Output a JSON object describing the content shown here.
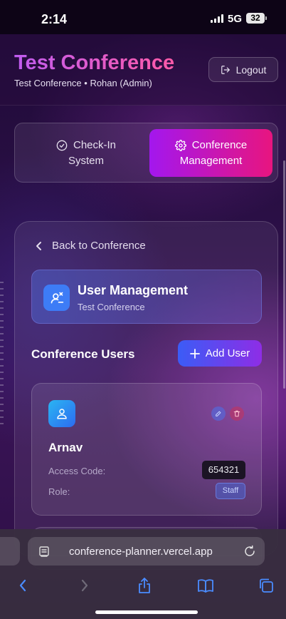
{
  "status_bar": {
    "time": "2:14",
    "network": "5G",
    "battery": "32"
  },
  "header": {
    "title": "Test Conference",
    "subtitle": "Test Conference • Rohan (Admin)",
    "logout_label": "Logout"
  },
  "tabs": [
    {
      "line1": "Check-In",
      "line2": "System",
      "icon": "check-circle-icon",
      "active": false
    },
    {
      "line1": "Conference",
      "line2": "Management",
      "icon": "gear-icon",
      "active": true
    }
  ],
  "main": {
    "back_label": "Back to Conference",
    "banner": {
      "title": "User Management",
      "subtitle": "Test Conference"
    },
    "section_title": "Conference Users",
    "add_user_label": "Add User",
    "users": [
      {
        "name": "Arnav",
        "access_code_label": "Access Code:",
        "access_code": "654321",
        "role_label": "Role:",
        "role": "Staff"
      }
    ]
  },
  "browser": {
    "url": "conference-planner.vercel.app"
  },
  "colors": {
    "accent_purple": "#a317ee",
    "accent_pink": "#e8157f",
    "accent_blue": "#3b5cf6",
    "avatar_blue": "#2d6bf0"
  }
}
